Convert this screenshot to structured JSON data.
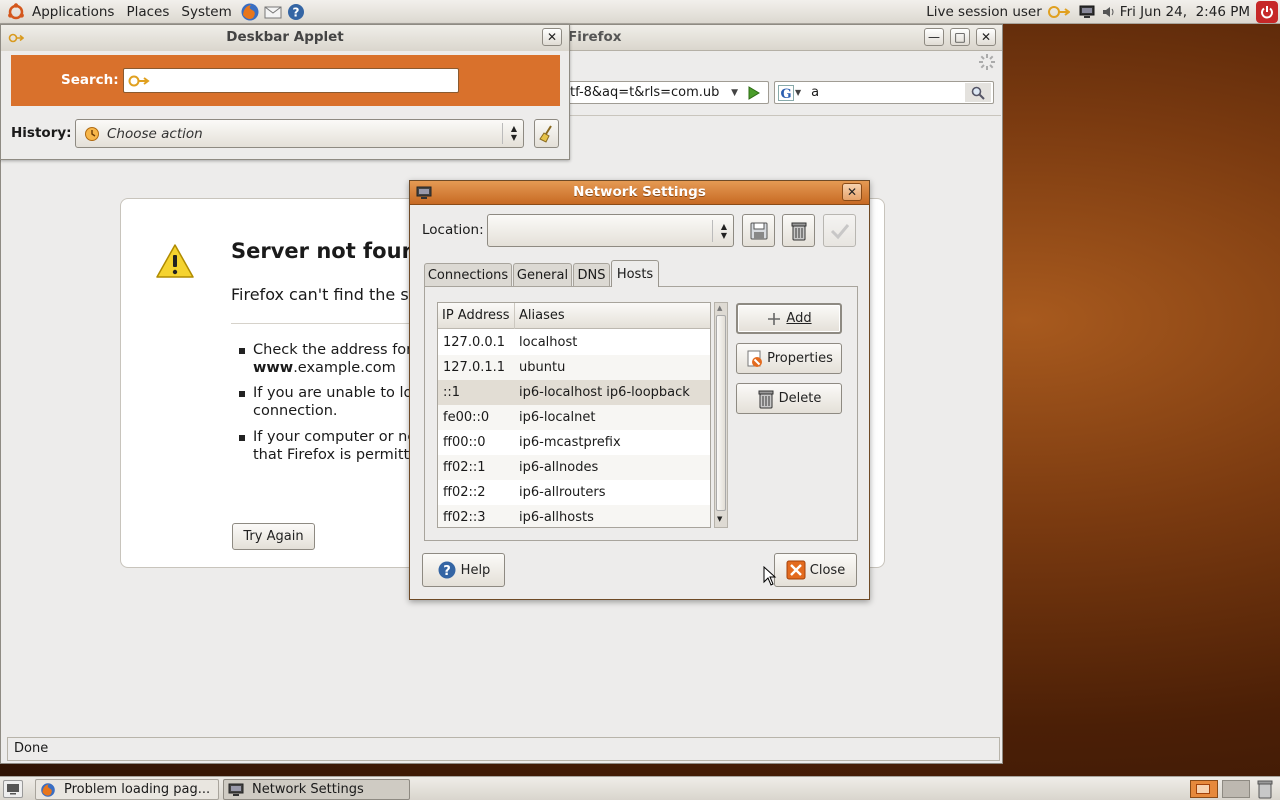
{
  "top_panel": {
    "menus": [
      "Applications",
      "Places",
      "System"
    ],
    "user": "Live session user",
    "clock": "Fri Jun 24,  2:46 PM"
  },
  "firefox": {
    "title": "Firefox",
    "url_fragment": "tf-8&aq=t&rls=com.ub",
    "search_value": "a",
    "error": {
      "heading": "Server not foun",
      "subheading": "Firefox can't find the s",
      "bullet1_line1": "Check the address for",
      "bullet1_line2_bold": "www",
      "bullet1_line2_rest": ".example.com",
      "bullet2_line1": "If you are unable to lo",
      "bullet2_line2": "connection.",
      "bullet3_line1": "If your computer or ne",
      "bullet3_line2": "that Firefox is permitt",
      "try_again": "Try Again"
    },
    "status": "Done"
  },
  "deskbar": {
    "title": "Deskbar Applet",
    "search_label": "Search:",
    "search_value": "",
    "history_label": "History:",
    "history_value": "Choose action"
  },
  "network_settings": {
    "title": "Network Settings",
    "location_label": "Location:",
    "location_value": "",
    "tabs": [
      "Connections",
      "General",
      "DNS",
      "Hosts"
    ],
    "active_tab": "Hosts",
    "columns": [
      "IP Address",
      "Aliases"
    ],
    "hosts": [
      {
        "ip": "127.0.0.1",
        "aliases": "localhost"
      },
      {
        "ip": "127.0.1.1",
        "aliases": "ubuntu"
      },
      {
        "ip": "::1",
        "aliases": "ip6-localhost ip6-loopback"
      },
      {
        "ip": "fe00::0",
        "aliases": "ip6-localnet"
      },
      {
        "ip": "ff00::0",
        "aliases": "ip6-mcastprefix"
      },
      {
        "ip": "ff02::1",
        "aliases": "ip6-allnodes"
      },
      {
        "ip": "ff02::2",
        "aliases": "ip6-allrouters"
      },
      {
        "ip": "ff02::3",
        "aliases": "ip6-allhosts"
      }
    ],
    "selected_row": "::1",
    "add_label": "Add",
    "properties_label": "Properties",
    "delete_label": "Delete",
    "help_label": "Help",
    "close_label": "Close"
  },
  "taskbar": {
    "tasks": [
      "Problem loading pag...",
      "Network Settings"
    ]
  },
  "colors": {
    "accent": "#d9712c",
    "title_active": "#c76a24",
    "selection": "#e2ddd4"
  }
}
